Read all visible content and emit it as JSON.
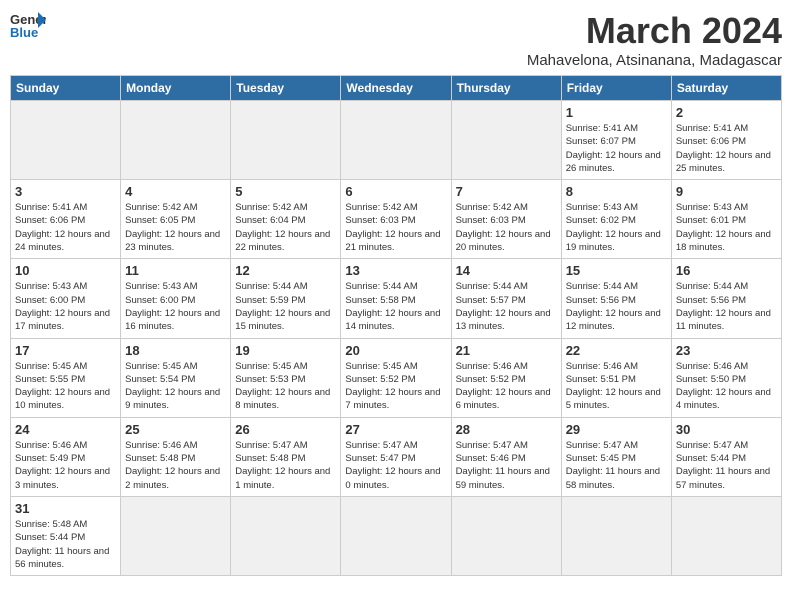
{
  "header": {
    "logo_line1": "General",
    "logo_line2": "Blue",
    "main_title": "March 2024",
    "subtitle": "Mahavelona, Atsinanana, Madagascar"
  },
  "weekdays": [
    "Sunday",
    "Monday",
    "Tuesday",
    "Wednesday",
    "Thursday",
    "Friday",
    "Saturday"
  ],
  "weeks": [
    [
      {
        "day": "",
        "empty": true
      },
      {
        "day": "",
        "empty": true
      },
      {
        "day": "",
        "empty": true
      },
      {
        "day": "",
        "empty": true
      },
      {
        "day": "",
        "empty": true
      },
      {
        "day": "1",
        "sunrise": "5:41 AM",
        "sunset": "6:07 PM",
        "daylight": "12 hours and 26 minutes."
      },
      {
        "day": "2",
        "sunrise": "5:41 AM",
        "sunset": "6:06 PM",
        "daylight": "12 hours and 25 minutes."
      }
    ],
    [
      {
        "day": "3",
        "sunrise": "5:41 AM",
        "sunset": "6:06 PM",
        "daylight": "12 hours and 24 minutes."
      },
      {
        "day": "4",
        "sunrise": "5:42 AM",
        "sunset": "6:05 PM",
        "daylight": "12 hours and 23 minutes."
      },
      {
        "day": "5",
        "sunrise": "5:42 AM",
        "sunset": "6:04 PM",
        "daylight": "12 hours and 22 minutes."
      },
      {
        "day": "6",
        "sunrise": "5:42 AM",
        "sunset": "6:03 PM",
        "daylight": "12 hours and 21 minutes."
      },
      {
        "day": "7",
        "sunrise": "5:42 AM",
        "sunset": "6:03 PM",
        "daylight": "12 hours and 20 minutes."
      },
      {
        "day": "8",
        "sunrise": "5:43 AM",
        "sunset": "6:02 PM",
        "daylight": "12 hours and 19 minutes."
      },
      {
        "day": "9",
        "sunrise": "5:43 AM",
        "sunset": "6:01 PM",
        "daylight": "12 hours and 18 minutes."
      }
    ],
    [
      {
        "day": "10",
        "sunrise": "5:43 AM",
        "sunset": "6:00 PM",
        "daylight": "12 hours and 17 minutes."
      },
      {
        "day": "11",
        "sunrise": "5:43 AM",
        "sunset": "6:00 PM",
        "daylight": "12 hours and 16 minutes."
      },
      {
        "day": "12",
        "sunrise": "5:44 AM",
        "sunset": "5:59 PM",
        "daylight": "12 hours and 15 minutes."
      },
      {
        "day": "13",
        "sunrise": "5:44 AM",
        "sunset": "5:58 PM",
        "daylight": "12 hours and 14 minutes."
      },
      {
        "day": "14",
        "sunrise": "5:44 AM",
        "sunset": "5:57 PM",
        "daylight": "12 hours and 13 minutes."
      },
      {
        "day": "15",
        "sunrise": "5:44 AM",
        "sunset": "5:56 PM",
        "daylight": "12 hours and 12 minutes."
      },
      {
        "day": "16",
        "sunrise": "5:44 AM",
        "sunset": "5:56 PM",
        "daylight": "12 hours and 11 minutes."
      }
    ],
    [
      {
        "day": "17",
        "sunrise": "5:45 AM",
        "sunset": "5:55 PM",
        "daylight": "12 hours and 10 minutes."
      },
      {
        "day": "18",
        "sunrise": "5:45 AM",
        "sunset": "5:54 PM",
        "daylight": "12 hours and 9 minutes."
      },
      {
        "day": "19",
        "sunrise": "5:45 AM",
        "sunset": "5:53 PM",
        "daylight": "12 hours and 8 minutes."
      },
      {
        "day": "20",
        "sunrise": "5:45 AM",
        "sunset": "5:52 PM",
        "daylight": "12 hours and 7 minutes."
      },
      {
        "day": "21",
        "sunrise": "5:46 AM",
        "sunset": "5:52 PM",
        "daylight": "12 hours and 6 minutes."
      },
      {
        "day": "22",
        "sunrise": "5:46 AM",
        "sunset": "5:51 PM",
        "daylight": "12 hours and 5 minutes."
      },
      {
        "day": "23",
        "sunrise": "5:46 AM",
        "sunset": "5:50 PM",
        "daylight": "12 hours and 4 minutes."
      }
    ],
    [
      {
        "day": "24",
        "sunrise": "5:46 AM",
        "sunset": "5:49 PM",
        "daylight": "12 hours and 3 minutes."
      },
      {
        "day": "25",
        "sunrise": "5:46 AM",
        "sunset": "5:48 PM",
        "daylight": "12 hours and 2 minutes."
      },
      {
        "day": "26",
        "sunrise": "5:47 AM",
        "sunset": "5:48 PM",
        "daylight": "12 hours and 1 minute."
      },
      {
        "day": "27",
        "sunrise": "5:47 AM",
        "sunset": "5:47 PM",
        "daylight": "12 hours and 0 minutes."
      },
      {
        "day": "28",
        "sunrise": "5:47 AM",
        "sunset": "5:46 PM",
        "daylight": "11 hours and 59 minutes."
      },
      {
        "day": "29",
        "sunrise": "5:47 AM",
        "sunset": "5:45 PM",
        "daylight": "11 hours and 58 minutes."
      },
      {
        "day": "30",
        "sunrise": "5:47 AM",
        "sunset": "5:44 PM",
        "daylight": "11 hours and 57 minutes."
      }
    ],
    [
      {
        "day": "31",
        "sunrise": "5:48 AM",
        "sunset": "5:44 PM",
        "daylight": "11 hours and 56 minutes."
      },
      {
        "day": "",
        "empty": true
      },
      {
        "day": "",
        "empty": true
      },
      {
        "day": "",
        "empty": true
      },
      {
        "day": "",
        "empty": true
      },
      {
        "day": "",
        "empty": true
      },
      {
        "day": "",
        "empty": true
      }
    ]
  ]
}
